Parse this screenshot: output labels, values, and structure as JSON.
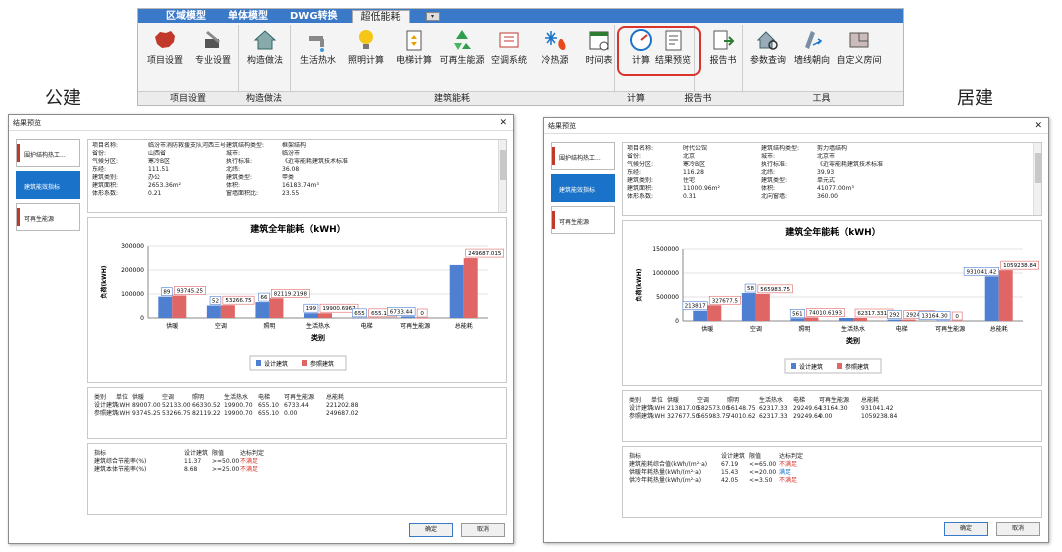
{
  "ribbon": {
    "tabs": [
      "区域模型",
      "单体模型",
      "DWG转换",
      "超低能耗"
    ],
    "active_tab": "超低能耗",
    "items": [
      {
        "id": "project-settings",
        "label": "项目设置",
        "icon": "china-map-icon"
      },
      {
        "id": "pro-settings",
        "label": "专业设置",
        "icon": "tools-icon"
      },
      {
        "id": "construction",
        "label": "构造做法",
        "icon": "house-icon"
      },
      {
        "id": "hot-water",
        "label": "生活热水",
        "icon": "faucet-icon"
      },
      {
        "id": "lighting",
        "label": "照明计算",
        "icon": "bulb-icon"
      },
      {
        "id": "elevator",
        "label": "电梯计算",
        "icon": "elevator-icon"
      },
      {
        "id": "renewable",
        "label": "可再生能源",
        "icon": "recycle-icon"
      },
      {
        "id": "hvac",
        "label": "空调系统",
        "icon": "hvac-icon"
      },
      {
        "id": "heat-cold",
        "label": "冷热源",
        "icon": "snowflake-fire-icon"
      },
      {
        "id": "schedule",
        "label": "时间表",
        "icon": "calendar-icon"
      },
      {
        "id": "calculate",
        "label": "计算",
        "icon": "gauge-icon"
      },
      {
        "id": "preview",
        "label": "结果预览",
        "icon": "document-icon"
      },
      {
        "id": "report",
        "label": "报告书",
        "icon": "report-export-icon"
      },
      {
        "id": "param-query",
        "label": "参数查询",
        "icon": "house-search-icon"
      },
      {
        "id": "wall-orient",
        "label": "墙线朝向",
        "icon": "wall-arrow-icon"
      },
      {
        "id": "custom-room",
        "label": "自定义房间",
        "icon": "custom-room-icon"
      }
    ],
    "groups": [
      "项目设置",
      "构造做法",
      "建筑能耗",
      "计算",
      "报告书",
      "工具"
    ]
  },
  "labels": {
    "left": "公建",
    "right": "居建"
  },
  "left": {
    "title": "结果预览",
    "nav": [
      "围护结构热工...",
      "建筑能效指标",
      "可再生能源"
    ],
    "info": [
      [
        "项目名称:",
        "临汾市消防救援支队河西三号消...",
        "建筑结构类型:",
        "框架结构"
      ],
      [
        "省份:",
        "山西省",
        "城市:",
        "临汾市"
      ],
      [
        "气候分区:",
        "寒冷B区",
        "执行标准:",
        "《近零能耗建筑技术标准"
      ],
      [
        "东经:",
        "111.51",
        "北纬:",
        "36.08"
      ],
      [
        "建筑类别:",
        "办公",
        "建筑类型:",
        "甲类"
      ],
      [
        "建筑面积:",
        "2653.36m²",
        "体积:",
        "16183.74m³"
      ],
      [
        "体形系数:",
        "0.21",
        "窗墙面积比:",
        "23.55"
      ]
    ],
    "chart_data": {
      "type": "bar",
      "title": "建筑全年能耗（kWH）",
      "xlabel": "类别",
      "ylabel": "负荷(kWH)",
      "categories": [
        "供暖",
        "空调",
        "照明",
        "生活热水",
        "电梯",
        "可再生能源",
        "总能耗"
      ],
      "ylim": [
        0,
        300000
      ],
      "yticks": [
        "0",
        "100000",
        "200000",
        "300000"
      ],
      "series": [
        {
          "name": "设计建筑",
          "color": "#4f7fd1",
          "values": [
            89007.0,
            52133.0,
            66330.52,
            19900.7,
            655.1,
            6733.44,
            221202.88
          ],
          "labels": [
            "89",
            "52",
            "66",
            "199",
            "655",
            "6733.44",
            ""
          ]
        },
        {
          "name": "参照建筑",
          "color": "#e06666",
          "values": [
            93745.25,
            53266.75,
            82119.22,
            19900.7,
            655.1,
            0.0,
            249687.02
          ],
          "labels": [
            "93745.25",
            "53266.75",
            "82119.2198",
            "19900.6967",
            "655.102",
            "0",
            "249687.015"
          ]
        }
      ],
      "legend": "bottom"
    },
    "data_table": {
      "header": [
        "类别",
        "单位",
        "供暖",
        "空调",
        "照明",
        "生活热水",
        "电梯",
        "可再生能源",
        "总能耗"
      ],
      "rows": [
        [
          "设计建筑",
          "kWH",
          "89007.00",
          "52133.00",
          "66330.52",
          "19900.70",
          "655.10",
          "6733.44",
          "221202.88"
        ],
        [
          "参照建筑",
          "kWH",
          "93745.25",
          "53266.75",
          "82119.22",
          "19900.70",
          "655.10",
          "0.00",
          "249687.02"
        ]
      ]
    },
    "indicators": {
      "header": [
        "指标",
        "设计建筑",
        "限值",
        "达标判定"
      ],
      "rows": [
        [
          "建筑综合节能率(%)",
          "11.37",
          ">=50.00",
          "不满足"
        ],
        [
          "建筑本体节能率(%)",
          "8.68",
          ">=25.00",
          "不满足"
        ]
      ]
    },
    "buttons": {
      "ok": "确定",
      "cancel": "取消"
    }
  },
  "right": {
    "title": "结果预览",
    "nav": [
      "围护结构热工...",
      "建筑能效指标",
      "可再生能源"
    ],
    "info": [
      [
        "项目名称:",
        "时代公馆",
        "建筑结构类型:",
        "剪力墙结构"
      ],
      [
        "省份:",
        "北京",
        "城市:",
        "北京市"
      ],
      [
        "气候分区:",
        "寒冷B区",
        "执行标准:",
        "《近零能耗建筑技术标准"
      ],
      [
        "东经:",
        "116.28",
        "北纬:",
        "39.93"
      ],
      [
        "建筑类别:",
        "住宅",
        "建筑类型:",
        "单元式"
      ],
      [
        "建筑面积:",
        "11000.96m²",
        "体积:",
        "41077.00m³"
      ],
      [
        "体形系数:",
        "0.31",
        "北向窗墙:",
        "360.00"
      ]
    ],
    "chart_data": {
      "type": "bar",
      "title": "建筑全年能耗（kWH）",
      "xlabel": "类别",
      "ylabel": "负荷(kWH)",
      "categories": [
        "供暖",
        "空调",
        "照明",
        "生活热水",
        "电梯",
        "可再生能源",
        "总能耗"
      ],
      "ylim": [
        0,
        1500000
      ],
      "yticks": [
        "0",
        "500000",
        "1000000",
        "1500000"
      ],
      "series": [
        {
          "name": "设计建筑",
          "color": "#4f7fd1",
          "values": [
            213817.0,
            582573.0,
            56148.75,
            62317.33,
            29249.64,
            13164.3,
            931041.42
          ],
          "labels": [
            "213817",
            "58",
            "561",
            "",
            "292",
            "13164.30",
            "931041.42"
          ]
        },
        {
          "name": "参照建筑",
          "color": "#e06666",
          "values": [
            327677.5,
            565983.75,
            74010.62,
            62317.33,
            29249.64,
            0.0,
            1059238.84
          ],
          "labels": [
            "327677.5",
            "565983.75",
            "74010.6193",
            "62317.3313",
            "29249.64",
            "0",
            "1059238.84"
          ]
        }
      ],
      "legend": "bottom"
    },
    "data_table": {
      "header": [
        "类别",
        "单位",
        "供暖",
        "空调",
        "照明",
        "生活热水",
        "电梯",
        "可再生能源",
        "总能耗"
      ],
      "rows": [
        [
          "设计建筑",
          "kWH",
          "213817.00",
          "582573.00",
          "56148.75",
          "62317.33",
          "29249.64",
          "13164.30",
          "931041.42"
        ],
        [
          "参照建筑",
          "kWH",
          "327677.50",
          "565983.75",
          "74010.62",
          "62317.33",
          "29249.64",
          "0.00",
          "1059238.84"
        ]
      ]
    },
    "indicators": {
      "header": [
        "指标",
        "设计建筑",
        "限值",
        "达标判定"
      ],
      "rows": [
        [
          "建筑能耗综合值(kWh/(m²·a)",
          "67.19",
          "<=65.00",
          "不满足"
        ],
        [
          "供暖年耗热量(kWh/(m²·a)",
          "15.43",
          "<=20.00",
          "满足"
        ],
        [
          "供冷年耗热量(kWh/(m²·a)",
          "42.05",
          "<=3.50",
          "不满足"
        ]
      ]
    },
    "buttons": {
      "ok": "确定",
      "cancel": "取消"
    }
  }
}
